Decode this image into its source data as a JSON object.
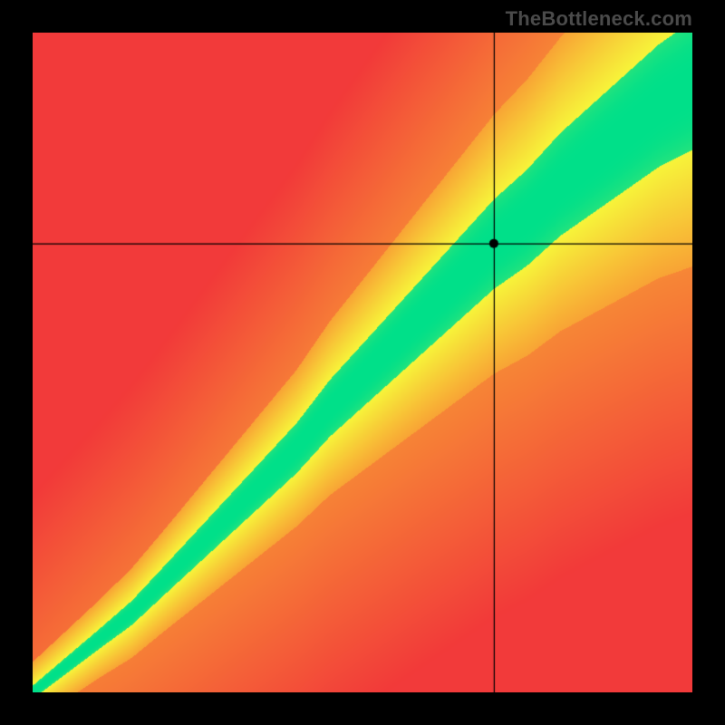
{
  "watermark": "TheBottleneck.com",
  "chart_data": {
    "type": "heatmap",
    "title": "",
    "xlabel": "",
    "ylabel": "",
    "xlim": [
      0,
      1
    ],
    "ylim": [
      0,
      1
    ],
    "crosshair": {
      "x": 0.7,
      "y": 0.68
    },
    "marker": {
      "x": 0.7,
      "y": 0.68
    },
    "band": {
      "description": "Green optimal band along a diagonal curve, yellow transition, red elsewhere. Upper-left region is red; lower-right is orange-red; diagonal from bottom-left to top-right is green with yellow halo.",
      "center_curve_samples": [
        {
          "x": 0.0,
          "y": 0.0
        },
        {
          "x": 0.05,
          "y": 0.04
        },
        {
          "x": 0.1,
          "y": 0.08
        },
        {
          "x": 0.15,
          "y": 0.12
        },
        {
          "x": 0.2,
          "y": 0.17
        },
        {
          "x": 0.25,
          "y": 0.22
        },
        {
          "x": 0.3,
          "y": 0.27
        },
        {
          "x": 0.35,
          "y": 0.32
        },
        {
          "x": 0.4,
          "y": 0.37
        },
        {
          "x": 0.45,
          "y": 0.43
        },
        {
          "x": 0.5,
          "y": 0.48
        },
        {
          "x": 0.55,
          "y": 0.53
        },
        {
          "x": 0.6,
          "y": 0.58
        },
        {
          "x": 0.65,
          "y": 0.63
        },
        {
          "x": 0.7,
          "y": 0.68
        },
        {
          "x": 0.75,
          "y": 0.72
        },
        {
          "x": 0.8,
          "y": 0.77
        },
        {
          "x": 0.85,
          "y": 0.81
        },
        {
          "x": 0.9,
          "y": 0.85
        },
        {
          "x": 0.95,
          "y": 0.89
        },
        {
          "x": 1.0,
          "y": 0.92
        }
      ],
      "green_halfwidth_samples": [
        {
          "x": 0.0,
          "w": 0.01
        },
        {
          "x": 0.1,
          "w": 0.015
        },
        {
          "x": 0.2,
          "w": 0.022
        },
        {
          "x": 0.3,
          "w": 0.03
        },
        {
          "x": 0.4,
          "w": 0.038
        },
        {
          "x": 0.5,
          "w": 0.048
        },
        {
          "x": 0.6,
          "w": 0.058
        },
        {
          "x": 0.7,
          "w": 0.068
        },
        {
          "x": 0.8,
          "w": 0.078
        },
        {
          "x": 0.9,
          "w": 0.088
        },
        {
          "x": 1.0,
          "w": 0.098
        }
      ]
    },
    "colors": {
      "green": "#00E08A",
      "yellow": "#F7F53A",
      "orange": "#F9A435",
      "red": "#F23A3A"
    }
  }
}
